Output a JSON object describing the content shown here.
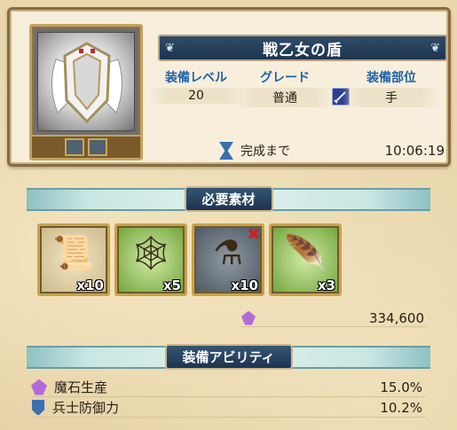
{
  "equipment": {
    "name": "戦乙女の盾",
    "stats": [
      {
        "label": "装備レベル",
        "value": "20"
      },
      {
        "label": "グレード",
        "value": "普通"
      },
      {
        "label": "装備部位",
        "value": "手"
      }
    ],
    "timer": {
      "label": "完成まで",
      "value": "10:06:19"
    }
  },
  "materials_section": {
    "title": "必要素材",
    "items": [
      {
        "icon": "scroll-icon",
        "qty": "x10",
        "missing": false
      },
      {
        "icon": "spiderweb-icon",
        "qty": "x5",
        "missing": false
      },
      {
        "icon": "potion-bottle-icon",
        "qty": "x10",
        "missing": true
      },
      {
        "icon": "feather-icon",
        "qty": "x3",
        "missing": false
      }
    ],
    "cost": "334,600"
  },
  "abilities_section": {
    "title": "装備アビリティ",
    "items": [
      {
        "name": "魔石生産",
        "value": "15.0%",
        "icon": "magic-crystal-icon"
      },
      {
        "name": "兵士防御力",
        "value": "10.2%",
        "icon": "shield-icon"
      }
    ]
  },
  "colors": {
    "accent_blue": "#1f63a8",
    "title_bar": "#1d3450",
    "missing_mark": "#d21d1d",
    "crystal": "#b36ad9"
  }
}
